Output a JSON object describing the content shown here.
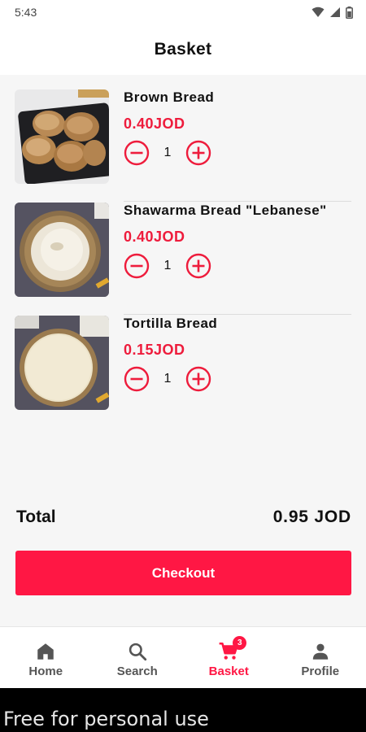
{
  "status_bar": {
    "time": "5:43"
  },
  "header": {
    "title": "Basket"
  },
  "items": [
    {
      "name": "Brown Bread",
      "price": "0.40JOD",
      "quantity": "1",
      "image_icon": "brown-bread-image"
    },
    {
      "name": "Shawarma Bread \"Lebanese\"",
      "price": "0.40JOD",
      "quantity": "1",
      "image_icon": "shawarma-bread-image"
    },
    {
      "name": "Tortilla Bread",
      "price": "0.15JOD",
      "quantity": "1",
      "image_icon": "tortilla-bread-image"
    }
  ],
  "total": {
    "label": "Total",
    "value": "0.95 JOD"
  },
  "checkout": {
    "label": "Checkout"
  },
  "nav": {
    "items": [
      {
        "label": "Home",
        "icon": "home-icon"
      },
      {
        "label": "Search",
        "icon": "search-icon"
      },
      {
        "label": "Basket",
        "icon": "cart-icon",
        "badge": "3",
        "active": true
      },
      {
        "label": "Profile",
        "icon": "person-icon"
      }
    ]
  },
  "banner": {
    "text": "Free for personal use"
  },
  "colors": {
    "accent": "#ff1744",
    "price": "#ee1c3c",
    "background": "#f6f6f6"
  }
}
